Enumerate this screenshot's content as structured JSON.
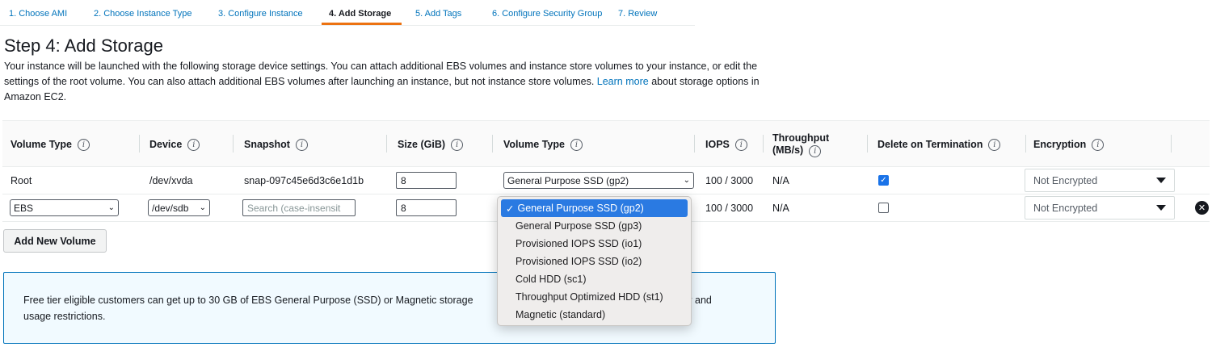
{
  "tabs": [
    {
      "label": "1. Choose AMI"
    },
    {
      "label": "2. Choose Instance Type"
    },
    {
      "label": "3. Configure Instance"
    },
    {
      "label": "4. Add Storage"
    },
    {
      "label": "5. Add Tags"
    },
    {
      "label": "6. Configure Security Group"
    },
    {
      "label": "7. Review"
    }
  ],
  "page": {
    "title": "Step 4: Add Storage",
    "desc_part1": "Your instance will be launched with the following storage device settings. You can attach additional EBS volumes and instance store volumes to your instance, or edit the settings of the root volume. You can also attach additional EBS volumes after launching an instance, but not instance store volumes. ",
    "learn_more": "Learn more",
    "desc_part2": " about storage options in Amazon EC2."
  },
  "table": {
    "headers": {
      "volume_type": "Volume Type",
      "device": "Device",
      "snapshot": "Snapshot",
      "size": "Size (GiB)",
      "volume_type2": "Volume Type",
      "iops": "IOPS",
      "throughput_line1": "Throughput",
      "throughput_line2": "(MB/s)",
      "delete": "Delete on Termination",
      "encryption": "Encryption"
    },
    "info_glyph": "i",
    "rows": [
      {
        "volume_type": "Root",
        "device": "/dev/xvda",
        "snapshot": "snap-097c45e6d3c6e1d1b",
        "size": "8",
        "vol_type_select": "General Purpose SSD (gp2)",
        "iops": "100 / 3000",
        "throughput": "N/A",
        "delete_checked": true,
        "encryption": "Not Encrypted"
      },
      {
        "volume_type": "EBS",
        "device": "/dev/sdb",
        "snapshot_placeholder": "Search (case-insensit",
        "size": "8",
        "iops": "100 / 3000",
        "throughput": "N/A",
        "delete_checked": false,
        "encryption": "Not Encrypted"
      }
    ],
    "check_glyph": "✓",
    "remove_glyph": "✕"
  },
  "add_button": "Add New Volume",
  "free_tier": {
    "text_before": "Free tier eligible customers can get up to 30 GB of EBS General Purpose (SSD) or Magnetic storage",
    "text_after": "bility and",
    "text_line2": "usage restrictions."
  },
  "dropdown": {
    "selected_mark": "✓",
    "options": [
      "General Purpose SSD (gp2)",
      "General Purpose SSD (gp3)",
      "Provisioned IOPS SSD (io1)",
      "Provisioned IOPS SSD (io2)",
      "Cold HDD (sc1)",
      "Throughput Optimized HDD (st1)",
      "Magnetic (standard)"
    ],
    "selected_index": 0
  },
  "chevron_glyph": "⌄",
  "colors": {
    "link": "#0073bb",
    "active_tab_underline": "#ec7211",
    "info_box_bg": "#f1faff",
    "info_box_border": "#0073bb",
    "dropdown_highlight": "#2a7ae2"
  }
}
